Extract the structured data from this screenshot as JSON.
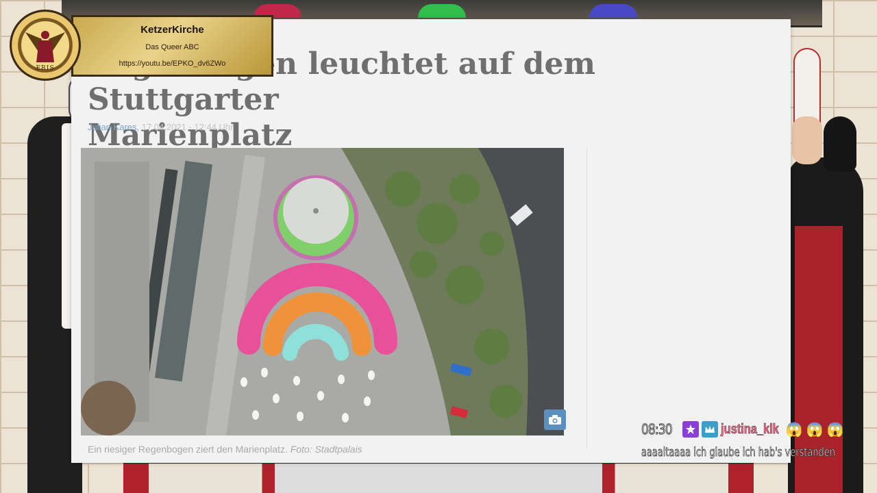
{
  "article": {
    "headline_line1": "Regenbogen leuchtet auf dem Stuttgarter",
    "headline_line2": "Marienplatz",
    "author": "Julian Kares,",
    "datetime": "17.04.2021 - 12:44 Uhr",
    "caption_text": "Ein riesiger Regenbogen ziert den Marienplatz.",
    "caption_credit": "Foto: Stadtpalais"
  },
  "badge": {
    "title": "KetzerKirche",
    "subtitle": "Das Queer ABC",
    "link": "https://youtu.be/EPKO_dv6ZWo",
    "logo_text": "ERIS"
  },
  "chat": {
    "time": "08:30",
    "username": "justina_klk",
    "emotes": [
      "😱",
      "😱",
      "😱"
    ],
    "message": "aaaaltaaaa ich glaube ich hab's verstanden"
  },
  "colors": {
    "rainbow_pink": "#e8509a",
    "rainbow_orange": "#f0923a",
    "rainbow_teal": "#8fe0d8",
    "author_link": "#7aa6d0",
    "chat_user": "#ff6b8a"
  }
}
